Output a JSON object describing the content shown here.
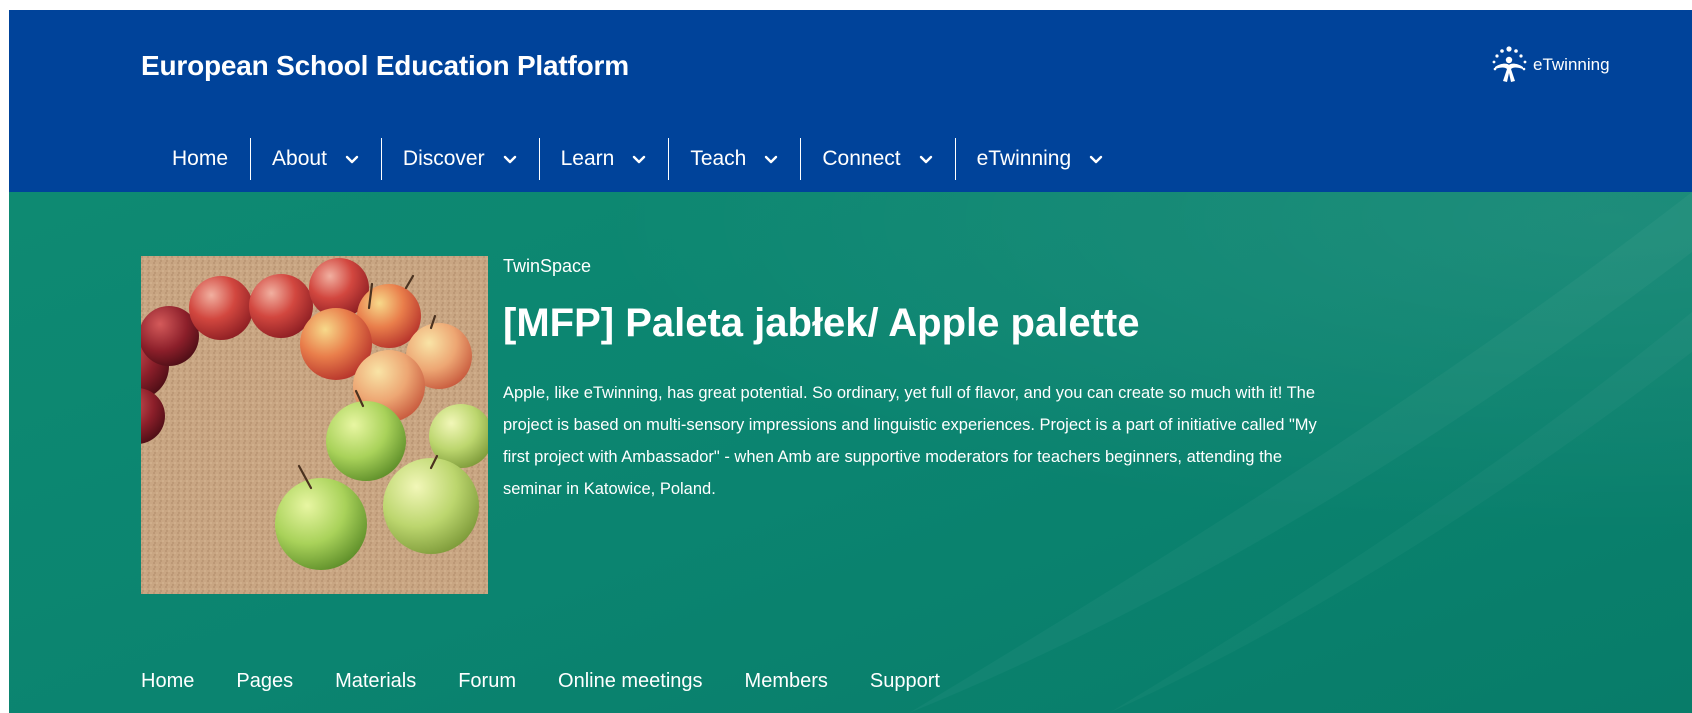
{
  "header": {
    "site_title": "European School Education Platform",
    "brand_logo_text": "eTwinning",
    "brand_icon": "etwinning-star-figure-icon",
    "background_color": "#00439a"
  },
  "main_nav": {
    "items": [
      {
        "label": "Home",
        "has_dropdown": false
      },
      {
        "label": "About",
        "has_dropdown": true
      },
      {
        "label": "Discover",
        "has_dropdown": true
      },
      {
        "label": "Learn",
        "has_dropdown": true
      },
      {
        "label": "Teach",
        "has_dropdown": true
      },
      {
        "label": "Connect",
        "has_dropdown": true
      },
      {
        "label": "eTwinning",
        "has_dropdown": true
      }
    ],
    "dropdown_icon": "chevron-down-icon"
  },
  "hero": {
    "background_color": "#0b8470",
    "eyebrow": "TwinSpace",
    "title": "[MFP] Paleta jabłek/ Apple palette",
    "description": "Apple, like eTwinning, has great potential. So ordinary, yet full of flavor, and you can create so much with it! The project is based on multi-sensory impressions and linguistic experiences. Project is a part of initiative called \"My first project with Ambassador\" - when Amb are supportive moderators for teachers beginners, attending the seminar in Katowice, Poland.",
    "image_alt": "apples arranged in a color gradient on a cork surface"
  },
  "project_tabs": [
    {
      "label": "Home"
    },
    {
      "label": "Pages"
    },
    {
      "label": "Materials"
    },
    {
      "label": "Forum"
    },
    {
      "label": "Online meetings"
    },
    {
      "label": "Members"
    },
    {
      "label": "Support"
    }
  ]
}
